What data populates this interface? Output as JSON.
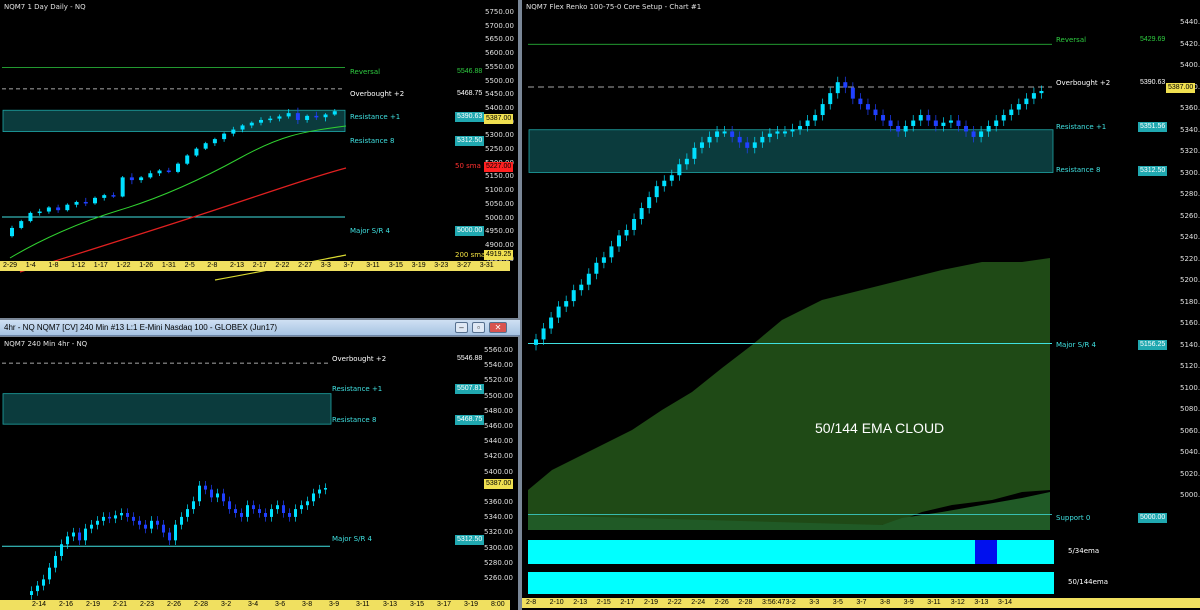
{
  "daily": {
    "title": "NQM7 1 Day  Daily - NQ",
    "axis": [
      "5750.00",
      "5700.00",
      "5650.00",
      "5600.00",
      "5550.00",
      "5500.00",
      "5450.00",
      "5400.00",
      "5350.00",
      "5300.00",
      "5250.00",
      "5200.00",
      "5150.00",
      "5100.00",
      "5050.00",
      "5000.00",
      "4950.00",
      "4900.00",
      "4850.00"
    ],
    "reversal": {
      "label": "Reversal",
      "value": "5546.88"
    },
    "overbought": {
      "label": "Overbought +2",
      "value": "5468.75"
    },
    "res1": {
      "label": "Resistance +1",
      "value": "5390.63"
    },
    "price": "5387.00",
    "res8": {
      "label": "Resistance 8",
      "value": "5312.50"
    },
    "sma50": {
      "label": "50 sma",
      "value": "5227.00"
    },
    "major": {
      "label": "Major S/R 4",
      "value": "5000.00"
    },
    "sma200": {
      "label": "200 sma",
      "value": "4919.25"
    },
    "dates": [
      "2-29",
      "1-4",
      "1-8",
      "1-12",
      "1-17",
      "1-22",
      "1-26",
      "1-31",
      "2-5",
      "2-8",
      "2-13",
      "2-17",
      "2-22",
      "2-27",
      "3-3",
      "3-7",
      "3-11",
      "3-15",
      "3-19",
      "3-23",
      "3-27",
      "3-31"
    ],
    "chart_data": {
      "type": "candlestick",
      "symbol": "NQM7",
      "interval": "1 Day",
      "price_min": 4850,
      "price_max": 5750,
      "ohlc_approx": [
        [
          4930,
          4968,
          4925,
          4960
        ],
        [
          4960,
          4990,
          4955,
          4985
        ],
        [
          4985,
          5020,
          4980,
          5015
        ],
        [
          5015,
          5030,
          5005,
          5020
        ],
        [
          5020,
          5040,
          5012,
          5035
        ],
        [
          5035,
          5045,
          5015,
          5025
        ],
        [
          5025,
          5050,
          5020,
          5045
        ],
        [
          5045,
          5060,
          5035,
          5055
        ],
        [
          5055,
          5070,
          5040,
          5050
        ],
        [
          5050,
          5075,
          5045,
          5070
        ],
        [
          5070,
          5085,
          5060,
          5080
        ],
        [
          5080,
          5090,
          5070,
          5075
        ],
        [
          5075,
          5150,
          5072,
          5145
        ],
        [
          5145,
          5160,
          5120,
          5135
        ],
        [
          5135,
          5150,
          5125,
          5145
        ],
        [
          5145,
          5170,
          5140,
          5160
        ],
        [
          5160,
          5175,
          5150,
          5170
        ],
        [
          5170,
          5180,
          5160,
          5165
        ],
        [
          5165,
          5200,
          5160,
          5195
        ],
        [
          5195,
          5230,
          5190,
          5225
        ],
        [
          5225,
          5255,
          5220,
          5250
        ],
        [
          5250,
          5275,
          5245,
          5270
        ],
        [
          5270,
          5290,
          5260,
          5285
        ],
        [
          5285,
          5310,
          5275,
          5305
        ],
        [
          5305,
          5330,
          5295,
          5320
        ],
        [
          5320,
          5340,
          5310,
          5335
        ],
        [
          5335,
          5350,
          5325,
          5345
        ],
        [
          5345,
          5365,
          5335,
          5355
        ],
        [
          5355,
          5370,
          5345,
          5360
        ],
        [
          5360,
          5375,
          5350,
          5368
        ],
        [
          5368,
          5395,
          5360,
          5380
        ],
        [
          5380,
          5400,
          5340,
          5355
        ],
        [
          5355,
          5375,
          5345,
          5370
        ],
        [
          5370,
          5385,
          5355,
          5365
        ],
        [
          5365,
          5380,
          5350,
          5375
        ],
        [
          5375,
          5395,
          5370,
          5387
        ]
      ],
      "lines": {
        "reversal": 5546.88,
        "overbought": 5468.75,
        "resistance_1": 5390.63,
        "resistance_8": 5312.5,
        "major_sr_4": 5000.0,
        "sma50": 5227.0,
        "sma200": 4919.25
      }
    }
  },
  "fourhr": {
    "window_title": "4hr - NQ  NQM7 [CV]  240 Min  #13  L:1  E-Mini Nasdaq 100 - GLOBEX (Jun17)",
    "title": "NQM7 240 Min  4hr - NQ",
    "axis": [
      "5560.00",
      "5540.00",
      "5520.00",
      "5500.00",
      "5480.00",
      "5460.00",
      "5440.00",
      "5420.00",
      "5400.00",
      "5380.00",
      "5360.00",
      "5340.00",
      "5320.00",
      "5300.00",
      "5280.00",
      "5260.00"
    ],
    "overbought": {
      "label": "Overbought +2",
      "value": "5546.88"
    },
    "res1": {
      "label": "Resistance +1",
      "value": "5507.81"
    },
    "res8": {
      "label": "Resistance 8",
      "value": "5468.75"
    },
    "price": "5387.00",
    "major": {
      "label": "Major S/R 4",
      "value": "5312.50"
    },
    "dates": [
      "2-14",
      "2-16",
      "2-19",
      "2-21",
      "2-23",
      "2-26",
      "2-28",
      "3-2",
      "3-4",
      "3-6",
      "3-8",
      "3-9",
      "3-11",
      "3-13",
      "3-15",
      "3-17",
      "3-19",
      "8:00"
    ],
    "chart_data": {
      "type": "candlestick",
      "interval": "240 Min",
      "price_min": 5250,
      "price_max": 5565,
      "lines": {
        "overbought": 5546.88,
        "resistance_1": 5507.81,
        "resistance_8": 5468.75,
        "major_sr_4": 5312.5
      }
    }
  },
  "renko": {
    "title": "NQM7 Flex Renko 100-75-0 Core Setup - Chart #1",
    "axis": [
      "5440.00",
      "5420.00",
      "5400.00",
      "5380.00",
      "5360.00",
      "5340.00",
      "5320.00",
      "5300.00",
      "5280.00",
      "5260.00",
      "5240.00",
      "5220.00",
      "5200.00",
      "5180.00",
      "5160.00",
      "5140.00",
      "5120.00",
      "5100.00",
      "5080.00",
      "5060.00",
      "5040.00",
      "5020.00",
      "5000.00"
    ],
    "reversal": {
      "label": "Reversal",
      "value": "5429.69"
    },
    "overbought": {
      "label": "Overbought +2",
      "value": "5390.63"
    },
    "price": "5387.00",
    "res1": {
      "label": "Resistance +1",
      "value": "5351.56"
    },
    "res8": {
      "label": "Resistance 8",
      "value": "5312.50"
    },
    "major": {
      "label": "Major S/R 4",
      "value": "5156.25"
    },
    "support": {
      "label": "Support 0",
      "value": "5000.00"
    },
    "cloud_label": "50/144 EMA CLOUD",
    "ema1_label": "5/34ema",
    "ema2_label": "50/144ema",
    "dates": [
      "2-8",
      "2-10",
      "2-13",
      "2-15",
      "2-17",
      "2-19",
      "2-22",
      "2-24",
      "2-26",
      "2-28",
      "3:56:47",
      "3-2",
      "3-3",
      "3-5",
      "3-7",
      "3-8",
      "3-9",
      "3-11",
      "3-12",
      "3-13",
      "3-14"
    ],
    "chart_data": {
      "type": "renko",
      "brick": "100-75-0",
      "price_min": 4995,
      "price_max": 5450,
      "lines": {
        "reversal": 5429.69,
        "overbought": 5390.63,
        "resistance_1": 5351.56,
        "resistance_8": 5312.5,
        "major_sr_4": 5156.25,
        "support_0": 5000.0
      }
    }
  }
}
